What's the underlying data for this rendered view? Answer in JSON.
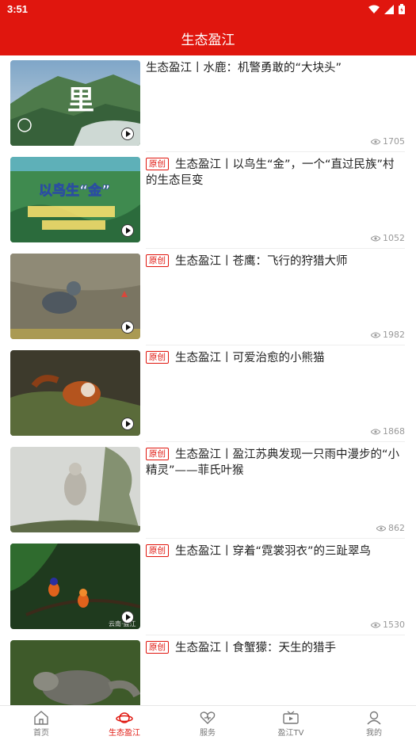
{
  "status": {
    "time": "3:51"
  },
  "appbar": {
    "title": "生态盈江"
  },
  "articles": [
    {
      "title": "生态盈江丨水鹿：机警勇敢的“大块头”",
      "badge": "",
      "views": "1705",
      "thumb_text": "里"
    },
    {
      "title": "生态盈江丨以鸟生“金”，一个“直过民族”村的生态巨变",
      "badge": "原创",
      "views": "1052",
      "thumb_text": "以鸟生“金”"
    },
    {
      "title": "生态盈江丨苍鹰：飞行的狩猎大师",
      "badge": "原创",
      "views": "1982",
      "thumb_text": ""
    },
    {
      "title": "生态盈江丨可爱治愈的小熊猫",
      "badge": "原创",
      "views": "1868",
      "thumb_text": ""
    },
    {
      "title": "生态盈江丨盈江苏典发现一只雨中漫步的“小精灵”——菲氏叶猴",
      "badge": "原创",
      "views": "862",
      "thumb_text": ""
    },
    {
      "title": "生态盈江丨穿着“霓裳羽衣”的三趾翠鸟",
      "badge": "原创",
      "views": "1530",
      "thumb_text": "云南·盈江"
    },
    {
      "title": "生态盈江丨食蟹獴：天生的猎手",
      "badge": "原创",
      "views": "",
      "thumb_text": ""
    }
  ],
  "tabs": [
    {
      "label": "首页",
      "icon": "home-icon",
      "active": false
    },
    {
      "label": "生态盈江",
      "icon": "planet-icon",
      "active": true
    },
    {
      "label": "服务",
      "icon": "service-icon",
      "active": false
    },
    {
      "label": "盈江TV",
      "icon": "tv-icon",
      "active": false
    },
    {
      "label": "我的",
      "icon": "user-icon",
      "active": false
    }
  ],
  "colors": {
    "brand": "#e0160e",
    "muted": "#999999"
  }
}
